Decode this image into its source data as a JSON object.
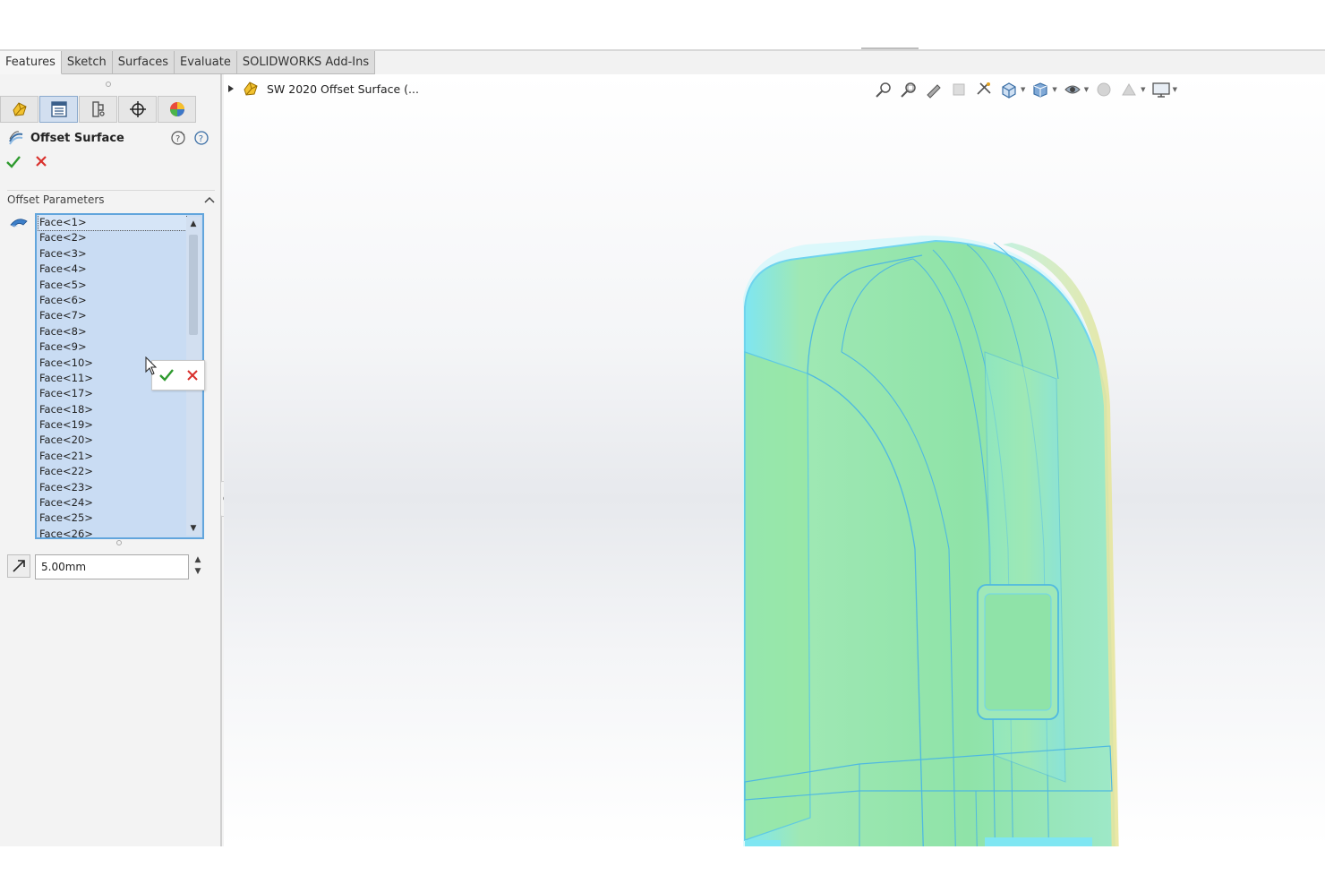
{
  "command_tabs": [
    "Features",
    "Sketch",
    "Surfaces",
    "Evaluate",
    "SOLIDWORKS Add-Ins"
  ],
  "property_manager": {
    "title": "Offset Surface",
    "section_title": "Offset Parameters",
    "faces": [
      "Face<1>",
      "Face<2>",
      "Face<3>",
      "Face<4>",
      "Face<5>",
      "Face<6>",
      "Face<7>",
      "Face<8>",
      "Face<9>",
      "Face<10>",
      "Face<11>",
      "Face<17>",
      "Face<18>",
      "Face<19>",
      "Face<20>",
      "Face<21>",
      "Face<22>",
      "Face<23>",
      "Face<24>",
      "Face<25>",
      "Face<26>"
    ],
    "offset_distance": "5.00mm"
  },
  "feature_tree": {
    "root_label": "SW 2020 Offset Surface  (..."
  },
  "colors": {
    "accent_blue": "#62a5dc",
    "selection_bg": "#c9dcf3",
    "ok_green": "#2e9a2e",
    "cancel_red": "#d9302c",
    "model_green": "#8fe3a8",
    "model_cyan": "#7fe6f2"
  },
  "icons": {
    "confirm": "check-icon",
    "cancel": "close-icon",
    "part": "part-icon"
  }
}
